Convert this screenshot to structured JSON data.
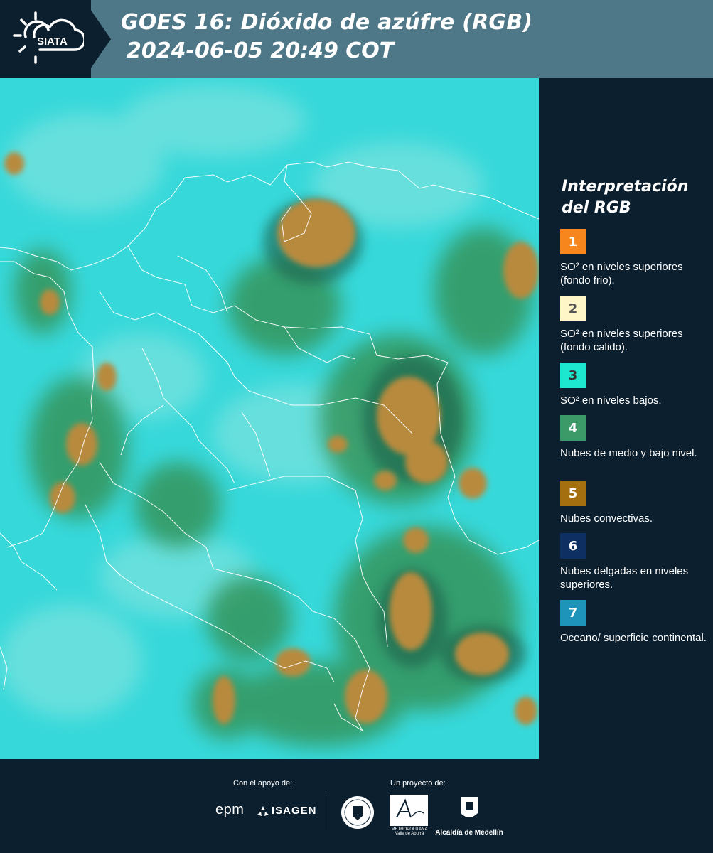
{
  "header": {
    "logo_text": "SIATA",
    "title": "GOES 16: Dióxido de azúfre (RGB)",
    "datetime": "2024-06-05 20:49 COT"
  },
  "legend": {
    "title_line1": "Interpretación",
    "title_line2": "del RGB",
    "items": [
      {
        "number": "1",
        "color": "#f7861c",
        "text": "SO² en niveles superiores (fondo frio)."
      },
      {
        "number": "2",
        "color": "#fef6c6",
        "text": "SO² en niveles superiores (fondo calido)."
      },
      {
        "number": "3",
        "color": "#1ee7cf",
        "text": "SO² en niveles bajos."
      },
      {
        "number": "4",
        "color": "#3c9a68",
        "text": "Nubes de medio y bajo nivel."
      },
      {
        "number": "5",
        "color": "#a4700f",
        "text": "Nubes convectivas."
      },
      {
        "number": "6",
        "color": "#0e2f62",
        "text": "Nubes delgadas en niveles superiores."
      },
      {
        "number": "7",
        "color": "#1f94bb",
        "text": "Oceano/ superficie continental."
      }
    ]
  },
  "footer": {
    "support_label": "Con el apoyo de:",
    "project_label": "Un proyecto de:",
    "sponsor1": "epm",
    "sponsor2": "ISAGEN",
    "area_text": "METROPOLITANA Valle de Aburrá",
    "alcaldia": "Alcaldía de Medellín"
  }
}
